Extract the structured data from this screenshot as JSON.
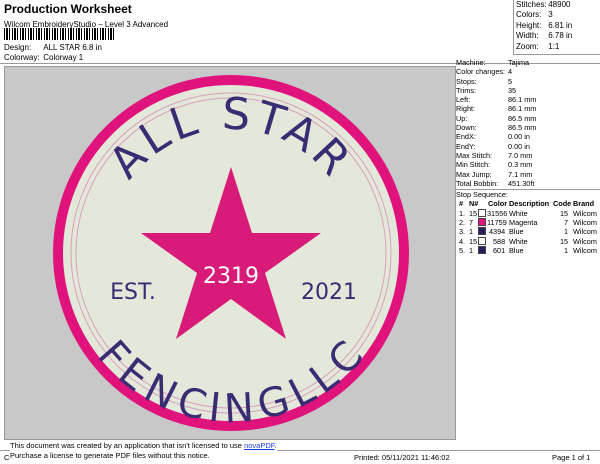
{
  "header": {
    "title": "Production Worksheet",
    "subtitle": "Wilcom EmbroideryStudio – Level 3 Advanced",
    "design_label": "Design:",
    "design_value": "ALL STAR 6.8 in",
    "colorway_label": "Colorway:",
    "colorway_value": "Colorway 1"
  },
  "stats": [
    {
      "label": "Stitches:",
      "value": "48900"
    },
    {
      "label": "Colors:",
      "value": "3"
    },
    {
      "label": "Height:",
      "value": "6.81 in"
    },
    {
      "label": "Width:",
      "value": "6.78 in"
    },
    {
      "label": "Zoom:",
      "value": "1:1"
    }
  ],
  "machine": [
    {
      "label": "Machine:",
      "value": "Tajima"
    },
    {
      "label": "Color changes:",
      "value": "4"
    },
    {
      "label": "Stops:",
      "value": "5"
    },
    {
      "label": "Trims:",
      "value": "35"
    },
    {
      "label": "Left:",
      "value": "86.1 mm"
    },
    {
      "label": "Right:",
      "value": "86.1 mm"
    },
    {
      "label": "Up:",
      "value": "86.5 mm"
    },
    {
      "label": "Down:",
      "value": "86.5 mm"
    },
    {
      "label": "EndX:",
      "value": "0.00 in"
    },
    {
      "label": "EndY:",
      "value": "0.00 in"
    },
    {
      "label": "Max Stitch:",
      "value": "7.0 mm"
    },
    {
      "label": "Min Stitch:",
      "value": "0.3 mm"
    },
    {
      "label": "Max Jump:",
      "value": "7.1 mm"
    },
    {
      "label": "Total Bobbin:",
      "value": "451.30ft"
    }
  ],
  "stop_sequence": {
    "title": "Stop Sequence:",
    "headers": [
      "#",
      "N#",
      "Color",
      "Description",
      "Code",
      "Brand"
    ],
    "rows": [
      {
        "num": "1.",
        "n": "15",
        "swatch": "#ffffff",
        "color": "31556",
        "desc": "White",
        "code": "15",
        "brand": "Wilcom"
      },
      {
        "num": "2.",
        "n": "7",
        "swatch": "#e0127c",
        "color": "11759",
        "desc": "Magenta",
        "code": "7",
        "brand": "Wilcom"
      },
      {
        "num": "3.",
        "n": "1",
        "swatch": "#2b1d5e",
        "color": "4394",
        "desc": "Blue",
        "code": "1",
        "brand": "Wilcom"
      },
      {
        "num": "4.",
        "n": "15",
        "swatch": "#ffffff",
        "color": "588",
        "desc": "White",
        "code": "15",
        "brand": "Wilcom"
      },
      {
        "num": "5.",
        "n": "1",
        "swatch": "#2b1d5e",
        "color": "601",
        "desc": "Blue",
        "code": "1",
        "brand": "Wilcom"
      }
    ]
  },
  "design": {
    "top_text": "ALL STAR",
    "bottom_text": "FENCINGLLC",
    "left_text": "EST.",
    "right_text": "2021",
    "center_text": "2319",
    "colors": {
      "ring": "#e0127c",
      "fill": "#e4e8da",
      "star": "#d81b78",
      "text": "#3a2c72",
      "canvas": "#c8c8c8"
    }
  },
  "footer": {
    "left": "Cr",
    "printed": "Printed: 05/11/2021 11:46:02",
    "page": "Page 1 of 1",
    "notice_line1": "This document was created by an application that isn't licensed to use",
    "notice_link": "novaPDF",
    "notice_line2": "Purchase a license to generate PDF files without this notice."
  }
}
